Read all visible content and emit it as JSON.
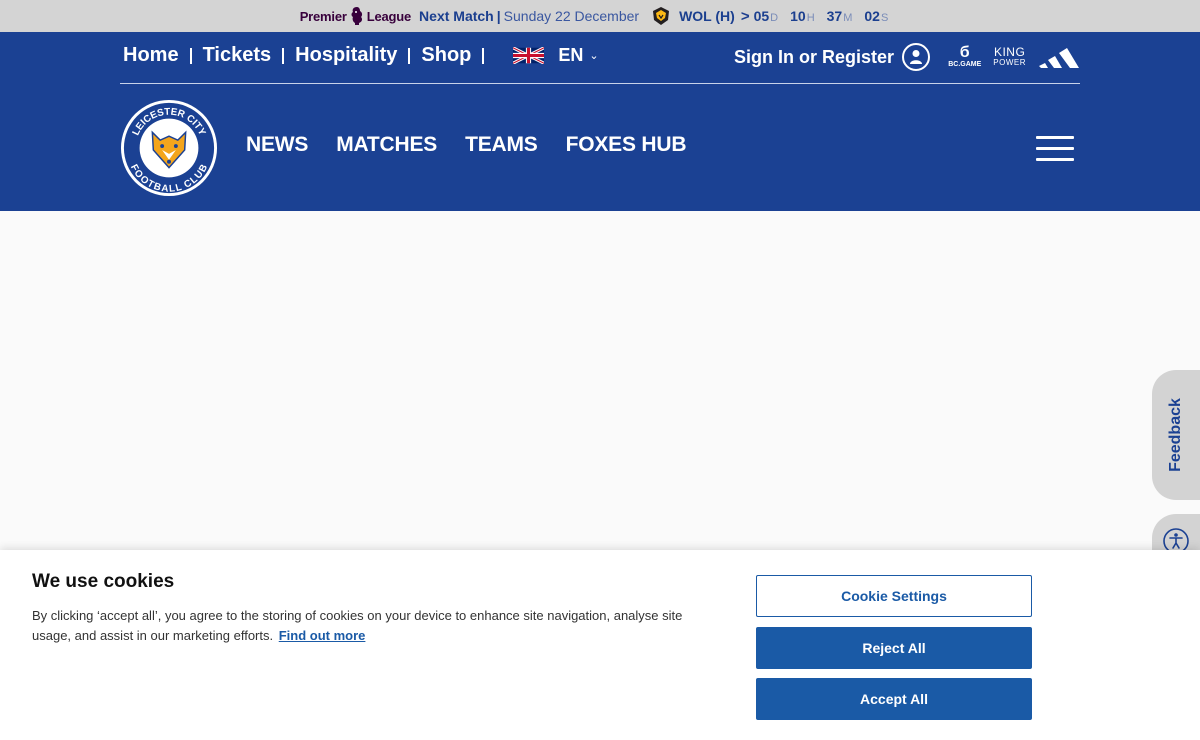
{
  "match_bar": {
    "league_left": "Premier",
    "league_right": "League",
    "next_label": "Next Match",
    "separator": "|",
    "date": "Sunday 22 December",
    "opponent": "WOL (H)",
    "arrow": ">",
    "countdown": [
      {
        "value": "05",
        "unit": "D"
      },
      {
        "value": "10",
        "unit": "H"
      },
      {
        "value": "37",
        "unit": "M"
      },
      {
        "value": "02",
        "unit": "S"
      }
    ]
  },
  "topnav": {
    "links": [
      "Home",
      "Tickets",
      "Hospitality",
      "Shop"
    ],
    "language": "EN",
    "signin": "Sign In or Register"
  },
  "sponsors": {
    "bc_game": "BC.GAME",
    "king_power_top": "KING",
    "king_power_bottom": "POWER"
  },
  "crest": {
    "top_text": "LEICESTER CITY",
    "bottom_text": "FOOTBALL CLUB"
  },
  "mainnav": [
    "NEWS",
    "MATCHES",
    "TEAMS",
    "FOXES HUB"
  ],
  "side": {
    "feedback": "Feedback"
  },
  "cookie": {
    "title": "We use cookies",
    "body": "By clicking ‘accept all’, you agree to the storing of cookies on your device to enhance site navigation, analyse site usage, and assist in our marketing efforts.",
    "link": "Find out more",
    "settings": "Cookie Settings",
    "reject": "Reject All",
    "accept": "Accept All"
  },
  "colors": {
    "brand_blue": "#1b4193",
    "button_blue": "#1a5aa6",
    "match_bar_bg": "#d4d4d4"
  }
}
